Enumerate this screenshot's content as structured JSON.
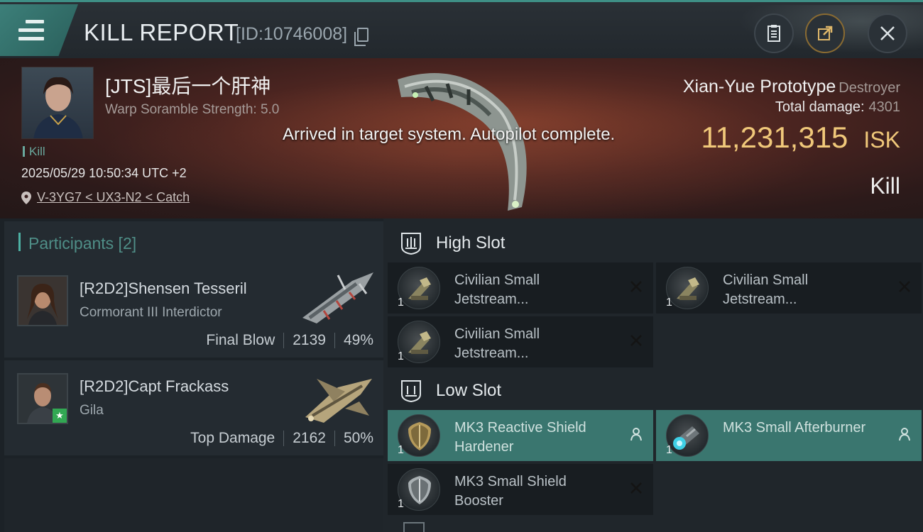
{
  "header": {
    "title": "KILL REPORT",
    "report_id": "[ID:10746008]"
  },
  "victim": {
    "name": "[JTS]最后一个肝神",
    "subtitle": "Warp Soramble Strength: 5.0",
    "tag": "Kill",
    "datetime": "2025/05/29 10:50:34 UTC +2",
    "location": "V-3YG7 < UX3-N2 < Catch"
  },
  "toast": "Arrived in target system. Autopilot complete.",
  "ship": {
    "name": "Xian-Yue Prototype",
    "class": "Destroyer",
    "damage_label": "Total damage:",
    "damage_value": "4301",
    "isk_amount": "11,231,315",
    "isk_label": "ISK",
    "result": "Kill"
  },
  "participants": {
    "label": "Participants [2]",
    "rows": [
      {
        "name": "[R2D2]Shensen Tesseril",
        "ship": "Cormorant III Interdictor",
        "role": "Final Blow",
        "damage": "2139",
        "percent": "49%"
      },
      {
        "name": "[R2D2]Capt Frackass",
        "ship": "Gila",
        "role": "Top Damage",
        "damage": "2162",
        "percent": "50%"
      }
    ]
  },
  "slots": {
    "high": {
      "label": "High Slot",
      "items": [
        {
          "qty": "1",
          "name": "Civilian Small Jetstream..."
        },
        {
          "qty": "1",
          "name": "Civilian Small Jetstream..."
        },
        {
          "qty": "1",
          "name": "Civilian Small Jetstream..."
        }
      ]
    },
    "low": {
      "label": "Low Slot",
      "items": [
        {
          "qty": "1",
          "name": "MK3 Reactive Shield Hardener"
        },
        {
          "qty": "1",
          "name": "MK3 Small Afterburner"
        },
        {
          "qty": "1",
          "name": "MK3 Small Shield Booster"
        }
      ]
    }
  },
  "colors": {
    "accent_teal": "#3a766f",
    "isk_gold": "#f0c87a",
    "kill_tag": "#69a89d"
  }
}
